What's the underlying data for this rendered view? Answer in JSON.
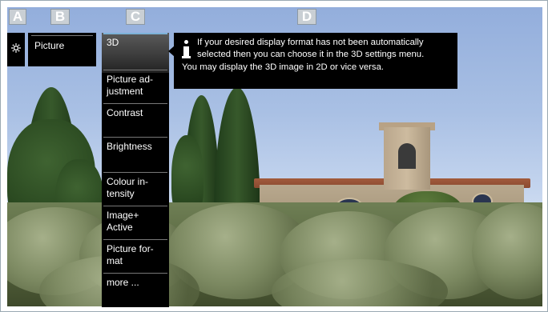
{
  "callouts": {
    "a": "A",
    "b": "B",
    "c": "C",
    "d": "D"
  },
  "settings_column": {
    "icon": "gear-icon"
  },
  "category": {
    "label": "Picture"
  },
  "menu": {
    "selected_index": 0,
    "items": [
      {
        "label": "3D"
      },
      {
        "label": "Picture ad-\njustment"
      },
      {
        "label": "Contrast"
      },
      {
        "label": "Brightness"
      },
      {
        "label": "Colour in-\ntensity"
      },
      {
        "label": "Image+\nActive"
      },
      {
        "label": "Picture for-\nmat"
      },
      {
        "label": "more ..."
      }
    ]
  },
  "info_box": {
    "icon": "info-icon",
    "line1": "If your desired display format has not been automatically",
    "line2": "selected then you can choose it in the 3D settings menu.",
    "line3": "You may display the 3D image in 2D or vice versa."
  },
  "colors": {
    "panel_bg": "#000000",
    "panel_text": "#ffffff",
    "selected_accent": "#7db2d8",
    "callout_bg": "#c9cfd4"
  }
}
